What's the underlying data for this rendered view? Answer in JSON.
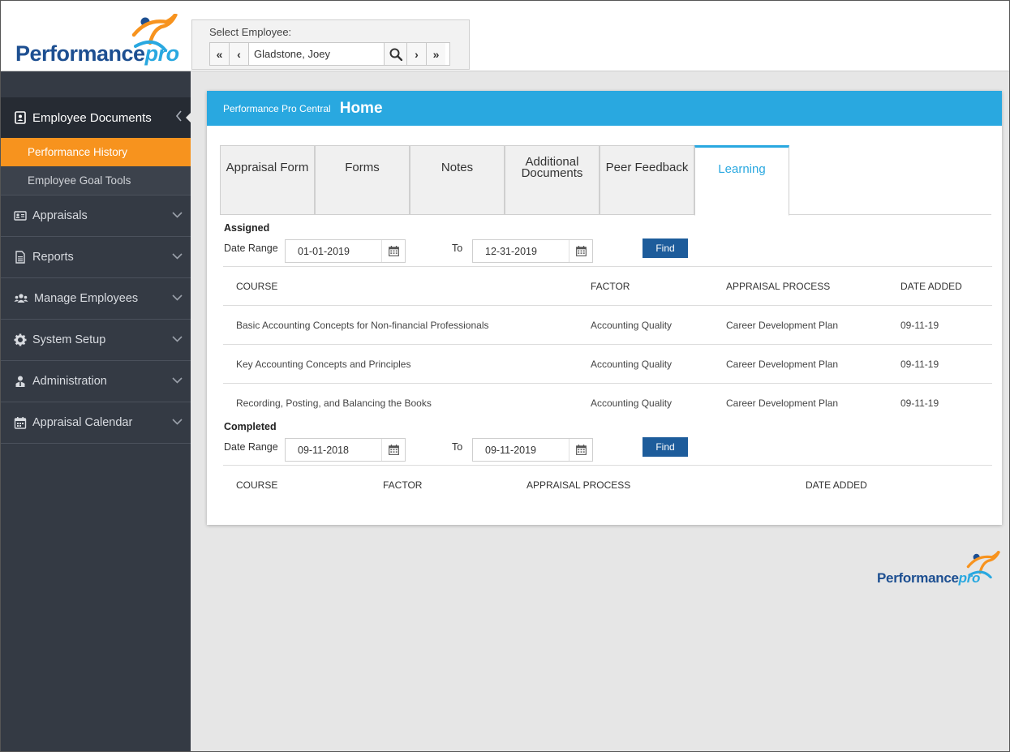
{
  "brand": {
    "name_main": "Performance",
    "name_accent": "pro"
  },
  "employee_select": {
    "label": "Select Employee:",
    "value": "Gladstone, Joey",
    "first_label": "«",
    "prev_label": "‹",
    "next_label": "›",
    "last_label": "»"
  },
  "sidebar": {
    "header": "Employee Documents",
    "sub_items": [
      "Performance History",
      "Employee Goal Tools"
    ],
    "items": [
      {
        "label": "Appraisals",
        "icon": "id-card-icon"
      },
      {
        "label": "Reports",
        "icon": "document-icon"
      },
      {
        "label": "Manage Employees",
        "icon": "users-icon"
      },
      {
        "label": "System Setup",
        "icon": "gear-icon"
      },
      {
        "label": "Administration",
        "icon": "admin-icon"
      },
      {
        "label": "Appraisal Calendar",
        "icon": "calendar-icon"
      }
    ]
  },
  "panel": {
    "subtitle": "Performance Pro Central",
    "title": "Home",
    "tabs": [
      {
        "line1": "Appraisal Form",
        "line2": ""
      },
      {
        "line1": "Forms",
        "line2": ""
      },
      {
        "line1": "Notes",
        "line2": ""
      },
      {
        "line1": "Additional",
        "line2": "Documents"
      },
      {
        "line1": "Peer Feedback",
        "line2": ""
      },
      {
        "line1": "Learning",
        "line2": ""
      }
    ],
    "active_tab": "Learning"
  },
  "assigned": {
    "title": "Assigned",
    "date_range_label": "Date Range",
    "from": "01-01-2019",
    "to_label": "To",
    "to": "12-31-2019",
    "find_label": "Find",
    "columns": [
      "COURSE",
      "FACTOR",
      "APPRAISAL PROCESS",
      "DATE ADDED"
    ],
    "rows": [
      [
        "Basic Accounting Concepts for Non-financial Professionals",
        "Accounting Quality",
        "Career Development Plan",
        "09-11-19"
      ],
      [
        "Key Accounting Concepts and Principles",
        "Accounting Quality",
        "Career Development Plan",
        "09-11-19"
      ],
      [
        "Recording, Posting, and Balancing the Books",
        "Accounting Quality",
        "Career Development Plan",
        "09-11-19"
      ]
    ]
  },
  "completed": {
    "title": "Completed",
    "date_range_label": "Date Range",
    "from": "09-11-2018",
    "to_label": "To",
    "to": "09-11-2019",
    "find_label": "Find",
    "columns": [
      "COURSE",
      "FACTOR",
      "APPRAISAL PROCESS",
      "DATE ADDED"
    ]
  },
  "colors": {
    "accent": "#29a8e0",
    "active": "#f7931e",
    "sidebar": "#343a44",
    "brand": "#1d4f91"
  }
}
